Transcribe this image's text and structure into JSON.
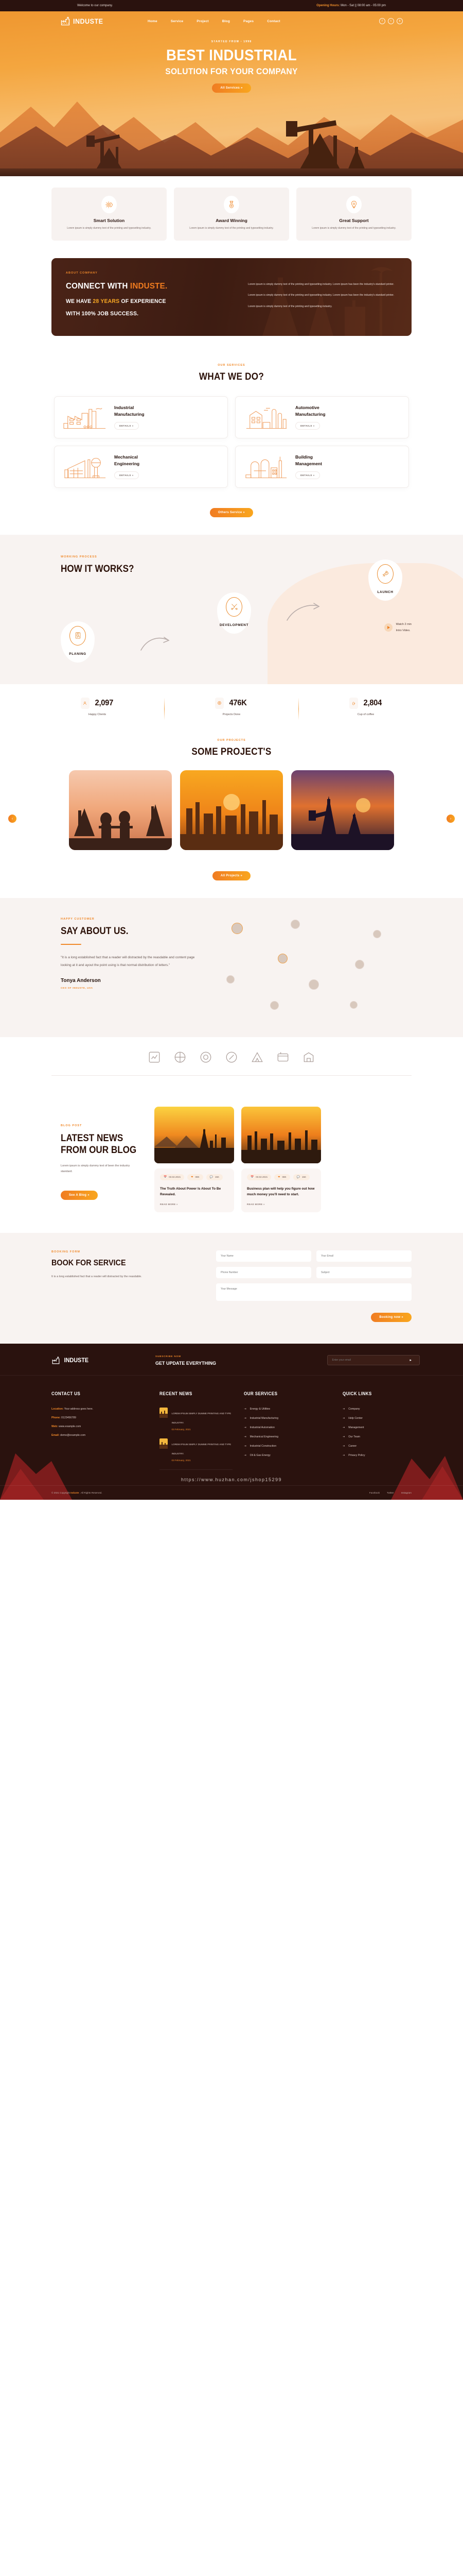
{
  "topbar": {
    "welcome": "Welcome to our company.",
    "hours_label": "Opening Hours:",
    "hours_value": "Mon - Sat || 08:00 am - 05:00 pm"
  },
  "header": {
    "brand": "INDUSTE",
    "logo_icon": "factory-icon",
    "nav": [
      {
        "label": "Home"
      },
      {
        "label": "Service"
      },
      {
        "label": "Project"
      },
      {
        "label": "Blog"
      },
      {
        "label": "Pages"
      },
      {
        "label": "Contact"
      }
    ],
    "socials": [
      {
        "name": "facebook-icon",
        "glyph": "f"
      },
      {
        "name": "twitter-icon",
        "glyph": "t"
      },
      {
        "name": "behance-icon",
        "glyph": "b"
      }
    ]
  },
  "hero": {
    "eyebrow": "STARTED FROM - 1998",
    "title_line1": "BEST INDUSTRIAL",
    "title_line2": "SOLUTION FOR YOUR COMPANY",
    "cta": "All Services »"
  },
  "features": [
    {
      "icon": "gear-brain-icon",
      "title": "Smart Solution",
      "text": "Lorem ipsum is simply dummy text of the printing and typesetting industry."
    },
    {
      "icon": "medal-icon",
      "title": "Award Winning",
      "text": "Lorem ipsum is simply dummy text of the printing and typesetting industry."
    },
    {
      "icon": "bulb-gear-icon",
      "title": "Great Support",
      "text": "Lorem ipsum is simply dummy text of the printing and typesetting industry."
    }
  ],
  "about": {
    "eyebrow": "ABOUT COMPANY",
    "h_line1_a": "CONNECT WITH ",
    "h_line1_b": "INDUSTE.",
    "h_line2_a": "WE HAVE ",
    "h_line2_b": "28 YEARS",
    "h_line2_c": " OF EXPERIENCE",
    "h_line3": "WITH 100% JOB SUCCESS.",
    "p1": "Lorem ipsum is simply dummy text of the printing and typesetting industry. Lorem ipsum has been the industry's standard printer.",
    "p2": "Lorem ipsum is simply dummy text of the printing and typesetting industry. Lorem ipsum has been the industry's standard printer.",
    "p3": "Lorem ipsum is simply dummy text of the printing and typesetting industry."
  },
  "services": {
    "eyebrow": "OUR SERVICES",
    "title": "WHAT WE DO?",
    "details_label": "DETAILS »",
    "cta": "Others Service »",
    "items": [
      {
        "icon": "factory-plant-icon",
        "title": "Industrial\nManufacturing"
      },
      {
        "icon": "refinery-icon",
        "title": "Automotive\nManufacturing"
      },
      {
        "icon": "watertower-icon",
        "title": "Mechanical\nEngineering"
      },
      {
        "icon": "silo-icon",
        "title": "Building\nManagement"
      }
    ]
  },
  "works": {
    "eyebrow": "WORKING PROCESS",
    "title": "HOW IT WORKS?",
    "steps": [
      {
        "icon": "clipboard-search-icon",
        "label": "PLANING"
      },
      {
        "icon": "tools-icon",
        "label": "DEVELOPMENT"
      },
      {
        "icon": "rocket-icon",
        "label": "LAUNCH"
      }
    ],
    "video_line1": "Watch 2 min",
    "video_line2": "Intro Video."
  },
  "counters": [
    {
      "icon": "user-icon",
      "value": "2,097",
      "label": "Happy Clients"
    },
    {
      "icon": "target-icon",
      "value": "476K",
      "label": "Projects Done"
    },
    {
      "icon": "coffee-icon",
      "value": "2,804",
      "label": "Cup of coffee"
    }
  ],
  "projects": {
    "eyebrow": "OUR PROJECTS",
    "title": "SOME PROJECT'S",
    "cta": "All Projects »",
    "prev_icon": "chevron-left-icon",
    "next_icon": "chevron-right-icon",
    "items": [
      {
        "name": "oil-workers-sunset"
      },
      {
        "name": "refinery-golden-hour"
      },
      {
        "name": "pumpjack-purple-dusk"
      }
    ]
  },
  "testimonial": {
    "eyebrow": "HAPPY CUSTOMER",
    "title": "SAY ABOUT US.",
    "quote": "\"It is a long established fact that a reader will distracted by the reasdable and content page looking at it and ayout the point using is that normal distribution of letters.\"",
    "name": "Tonya Anderson",
    "role": "CEO OF INDUSTE, USA"
  },
  "brands": {
    "logos": [
      "brand-logo-1",
      "brand-logo-2",
      "brand-logo-3",
      "brand-logo-4",
      "brand-logo-5",
      "brand-logo-6",
      "brand-logo-7"
    ]
  },
  "blog": {
    "eyebrow": "BLOG POST",
    "title_line1": "LATEST NEWS",
    "title_line2": "FROM OUR BLOG",
    "intro": "Lorem ipsum is simply dummy text of been the industry standard.",
    "cta": "See A Blog »",
    "read_more": "READ MORE »",
    "posts": [
      {
        "image": "desert-rig-sunset",
        "date": "03.02.2021",
        "likes": "08K",
        "comments": "15K",
        "title": "The Truth About Power Is About To Be Revealed."
      },
      {
        "image": "refinery-silhouette",
        "date": "03.02.2021",
        "likes": "08K",
        "comments": "15K",
        "title": "Business plan will help you figure out how much money you'll need to start."
      }
    ]
  },
  "book": {
    "eyebrow": "BOOKING FORM",
    "title": "BOOK FOR SERVICE",
    "text": "It is a long established fact that a reader will distracted by the reasdable.",
    "fields": {
      "name_placeholder": "Your Name",
      "email_placeholder": "Your Email",
      "phone_placeholder": "Phone Number",
      "subject_placeholder": "Subject",
      "message_placeholder": "Your Message"
    },
    "submit": "Booking now »"
  },
  "footer": {
    "brand": "INDUSTE",
    "subscribe_eyebrow": "SUBSCRIBE NOW",
    "subscribe_title": "GET UPDATE EVERYTHING",
    "subscribe_placeholder": "Enter your email",
    "subscribe_icon": "send-icon",
    "contact": {
      "heading": "CONTACT US",
      "lines": [
        {
          "label": "Location:",
          "value": "Your address goes here."
        },
        {
          "label": "Phone:",
          "value": "0123456789"
        },
        {
          "label": "Web:",
          "value": "www.example.com"
        },
        {
          "label": "Email:",
          "value": "demo@example.com"
        }
      ]
    },
    "news": {
      "heading": "RECENT NEWS",
      "items": [
        {
          "text": "LOREM IPSUM SIMPLY DUMME PRINTING AND TYPE INDUSTRY.",
          "date": "03 February, 2021"
        },
        {
          "text": "LOREM IPSUM SIMPLY DUMME PRINTING AND TYPE INDUSTRY.",
          "date": "03 February, 2021"
        }
      ]
    },
    "services": {
      "heading": "OUR SERVICES",
      "items": [
        "Energy & Utilities",
        "Industrial Manufacturing",
        "Industrial Automation",
        "Mechanical Engineering",
        "Industrial Construction",
        "Oil & Gas Energy"
      ]
    },
    "quick": {
      "heading": "QUICK LINKS",
      "items": [
        "Company",
        "Help Center",
        "Management",
        "Our Team",
        "Career",
        "Privacy Policy"
      ]
    },
    "copyright_a": "© 2021 Copyright ",
    "copyright_b": "Induste",
    "copyright_c": " . All Rights Reserved.",
    "bottom_links": [
      "Facebook",
      "Twitter",
      "Instagram"
    ]
  },
  "watermark": "https://www.huzhan.com/jshop15299",
  "colors": {
    "orange": "#f0892a",
    "orange_deep": "#ef7b1f",
    "yellow": "#f6a623",
    "dark": "#2a120e",
    "cream": "#f8f3f1"
  }
}
